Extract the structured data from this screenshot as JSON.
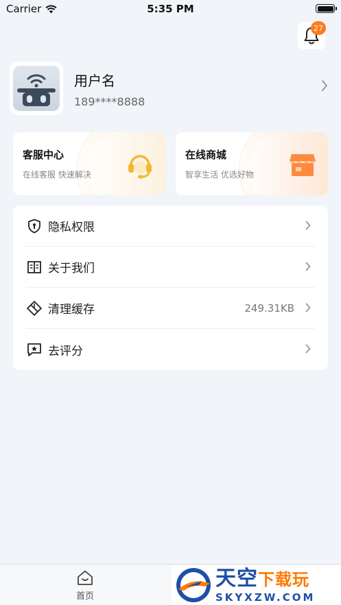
{
  "status_bar": {
    "carrier": "Carrier",
    "time": "5:35 PM"
  },
  "notifications": {
    "badge_count": "27",
    "icon": "bell-icon"
  },
  "profile": {
    "username": "用户名",
    "phone": "189****8888"
  },
  "cards": {
    "service": {
      "title": "客服中心",
      "subtitle": "在线客服 快速解决",
      "icon": "headset-icon"
    },
    "shop": {
      "title": "在线商城",
      "subtitle": "智享生活 优选好物",
      "icon": "store-icon"
    }
  },
  "menu": {
    "items": [
      {
        "label": "隐私权限",
        "icon": "shield-icon",
        "value": ""
      },
      {
        "label": "关于我们",
        "icon": "book-icon",
        "value": ""
      },
      {
        "label": "清理缓存",
        "icon": "eraser-icon",
        "value": "249.31KB"
      },
      {
        "label": "去评分",
        "icon": "rating-icon",
        "value": ""
      }
    ]
  },
  "tabbar": {
    "home_label": "首页"
  },
  "watermark": {
    "title_main": "天空",
    "title_accent": "下载玩",
    "domain": "SKYXZW.COM"
  },
  "colors": {
    "accent_orange": "#ff7a1a",
    "service_icon": "#f5b731",
    "shop_icon": "#ff8a3d",
    "background": "#f1f4f8"
  }
}
